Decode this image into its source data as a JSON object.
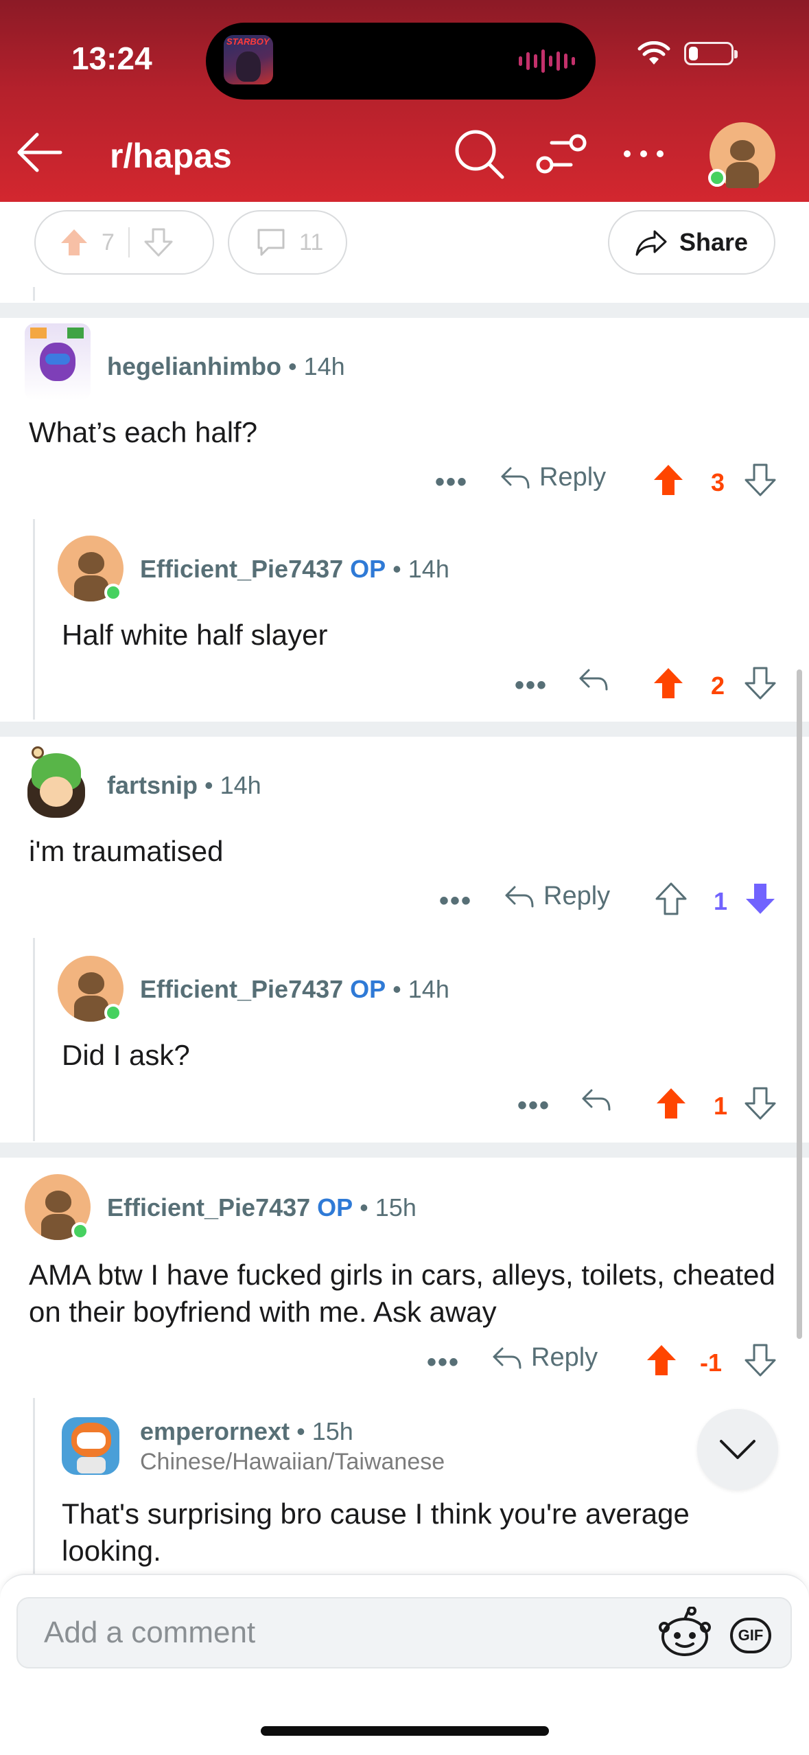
{
  "status_bar": {
    "time": "13:24",
    "battery_level": 0.22,
    "island_art_label": "STARBOY"
  },
  "header": {
    "subreddit": "r/hapas"
  },
  "post_actions": {
    "upvotes": "7",
    "comments": "11",
    "share_label": "Share"
  },
  "labels": {
    "reply": "Reply",
    "more": "•••",
    "op": "OP",
    "separator": "•"
  },
  "comments": [
    {
      "username": "hegelianhimbo",
      "is_op": false,
      "time": "14h",
      "body": "What’s each half?",
      "score": "3",
      "vote_state": "up",
      "show_reply_label": true
    },
    {
      "username": "Efficient_Pie7437",
      "is_op": true,
      "time": "14h",
      "body": "Half white half slayer",
      "score": "2",
      "vote_state": "up",
      "show_reply_label": false
    },
    {
      "username": "fartsnip",
      "is_op": false,
      "time": "14h",
      "body": "i'm traumatised",
      "score": "1",
      "vote_state": "down",
      "show_reply_label": true
    },
    {
      "username": "Efficient_Pie7437",
      "is_op": true,
      "time": "14h",
      "body": "Did I ask?",
      "score": "1",
      "vote_state": "up",
      "show_reply_label": false
    },
    {
      "username": "Efficient_Pie7437",
      "is_op": true,
      "time": "15h",
      "body": "AMA btw I have fucked girls in cars, alleys, toilets, cheated on their boyfriend with me. Ask away",
      "score": "-1",
      "vote_state": "up",
      "show_reply_label": true
    },
    {
      "username": "emperornext",
      "is_op": false,
      "time": "15h",
      "flair": "Chinese/Hawaiian/Taiwanese",
      "body": "That's surprising bro cause I think you're average looking."
    }
  ],
  "composer": {
    "placeholder": "Add a comment",
    "gif_label": "GIF"
  },
  "colors": {
    "header_red": "#d3272f",
    "upvote_orange": "#ff4500",
    "downvote_purple": "#7163fe",
    "op_blue": "#2f7ad6"
  }
}
